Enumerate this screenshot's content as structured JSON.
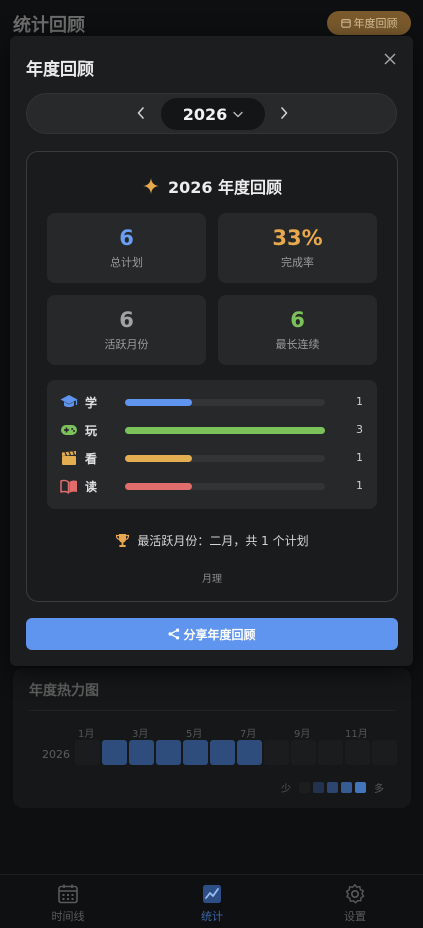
{
  "header": {
    "title": "统计回顾",
    "year_review_button": "年度回顾"
  },
  "heatmap": {
    "title": "年度热力图",
    "months": [
      "1月",
      "3月",
      "5月",
      "7月",
      "9月",
      "11月"
    ],
    "year": "2026",
    "active_months": [
      false,
      true,
      true,
      true,
      true,
      true,
      true,
      false,
      false,
      false,
      false,
      false
    ],
    "legend_less": "少",
    "legend_more": "多",
    "legend_colors": [
      "#1c1d1f",
      "#22324f",
      "#2c4670",
      "#375b93",
      "#4474bb"
    ]
  },
  "tabbar": [
    {
      "label": "时间线",
      "icon": "calendar-icon",
      "active": false
    },
    {
      "label": "统计",
      "icon": "chart-icon",
      "active": true
    },
    {
      "label": "设置",
      "icon": "gear-icon",
      "active": false
    }
  ],
  "modal": {
    "title": "年度回顾",
    "year": "2026",
    "review_title": "2026 年度回顾",
    "stats": [
      {
        "value": "6",
        "label": "总计划",
        "color": "#6a9ef2"
      },
      {
        "value": "33%",
        "label": "完成率",
        "color": "#e8a84e"
      },
      {
        "value": "6",
        "label": "活跃月份",
        "color": "#a2a2a2"
      },
      {
        "value": "6",
        "label": "最长连续",
        "color": "#7cc25a"
      }
    ],
    "categories": [
      {
        "name": "学",
        "count": "1",
        "ratio": 0.333,
        "color": "#5f95ee",
        "icon": "graduation-cap-icon"
      },
      {
        "name": "玩",
        "count": "3",
        "ratio": 1.0,
        "color": "#7cc25a",
        "icon": "gamepad-icon"
      },
      {
        "name": "看",
        "count": "1",
        "ratio": 0.333,
        "color": "#e3ad52",
        "icon": "clapperboard-icon"
      },
      {
        "name": "读",
        "count": "1",
        "ratio": 0.333,
        "color": "#e06c6c",
        "icon": "book-icon"
      }
    ],
    "most_active": "最活跃月份：二月，共 1 个计划",
    "footer_name": "月理",
    "share_button": "分享年度回顾"
  }
}
